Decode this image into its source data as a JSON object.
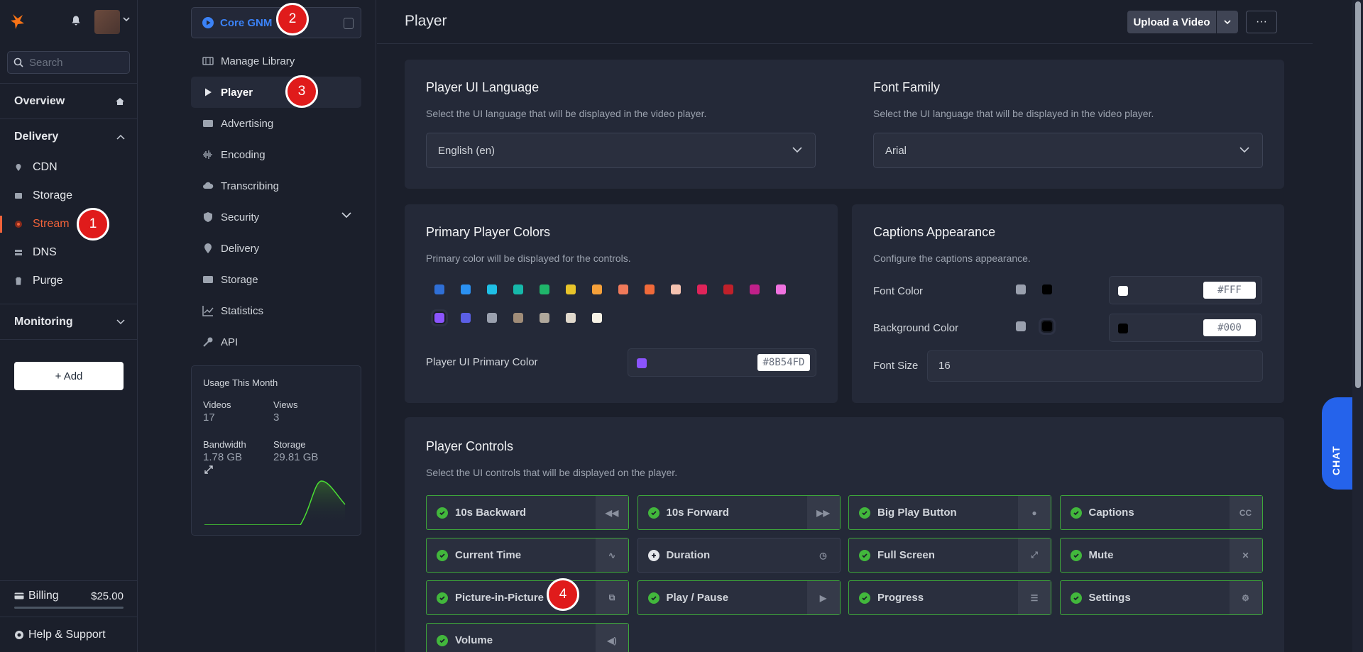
{
  "sidebar": {
    "search_placeholder": "Search",
    "overview": "Overview",
    "delivery": "Delivery",
    "items": [
      {
        "label": "CDN"
      },
      {
        "label": "Storage"
      },
      {
        "label": "Stream"
      },
      {
        "label": "DNS"
      },
      {
        "label": "Purge"
      }
    ],
    "monitoring": "Monitoring",
    "add": "+ Add",
    "billing_label": "Billing",
    "billing_amount": "$25.00",
    "help": "Help & Support"
  },
  "library": {
    "name": "Core GNM",
    "items": [
      {
        "label": "Manage Library"
      },
      {
        "label": "Player"
      },
      {
        "label": "Advertising"
      },
      {
        "label": "Encoding"
      },
      {
        "label": "Transcribing"
      },
      {
        "label": "Security"
      },
      {
        "label": "Delivery"
      },
      {
        "label": "Storage"
      },
      {
        "label": "Statistics"
      },
      {
        "label": "API"
      }
    ],
    "usage": {
      "title": "Usage This Month",
      "videos_label": "Videos",
      "videos": "17",
      "views_label": "Views",
      "views": "3",
      "bandwidth_label": "Bandwidth",
      "bandwidth": "1.78 GB",
      "storage_label": "Storage",
      "storage": "29.81 GB"
    }
  },
  "header": {
    "title": "Player",
    "upload": "Upload a Video",
    "more": "···"
  },
  "language": {
    "title": "Player UI Language",
    "desc": "Select the UI language that will be displayed in the video player.",
    "value": "English (en)"
  },
  "font": {
    "title": "Font Family",
    "desc": "Select the UI language that will be displayed in the video player.",
    "value": "Arial"
  },
  "colors": {
    "title": "Primary Player Colors",
    "desc": "Primary color will be displayed for the controls.",
    "swatches": [
      "#2f6fd6",
      "#2b91f2",
      "#1fbfe6",
      "#16b8aa",
      "#1fb56a",
      "#e8c42a",
      "#f5a03a",
      "#f07a5a",
      "#f06a3a",
      "#f5c2b0",
      "#e0245a",
      "#c0202a",
      "#c0208a",
      "#f072e0",
      "#8b54fd",
      "#5b5fe6",
      "#9aa0ae",
      "#a08c78",
      "#b0a89c",
      "#e0d8cc",
      "#f7f2e6"
    ],
    "primary_label": "Player UI Primary Color",
    "primary_hex": "#8B54FD",
    "primary_color": "#8B54FD"
  },
  "captions": {
    "title": "Captions Appearance",
    "desc": "Configure the captions appearance.",
    "font_color_label": "Font Color",
    "font_color_hex": "#FFF",
    "bg_color_label": "Background Color",
    "bg_color_hex": "#000",
    "font_size_label": "Font Size",
    "font_size": "16"
  },
  "controls": {
    "title": "Player Controls",
    "desc": "Select the UI controls that will be displayed on the player.",
    "items": [
      {
        "label": "10s Backward",
        "on": true,
        "icon": "rewind-icon"
      },
      {
        "label": "10s Forward",
        "on": true,
        "icon": "fast-forward-icon"
      },
      {
        "label": "Big Play Button",
        "on": true,
        "icon": "play-circle-icon"
      },
      {
        "label": "Captions",
        "on": true,
        "icon": "cc-icon"
      },
      {
        "label": "Current Time",
        "on": true,
        "icon": "wave-icon"
      },
      {
        "label": "Duration",
        "on": false,
        "icon": "timer-icon"
      },
      {
        "label": "Full Screen",
        "on": true,
        "icon": "expand-icon"
      },
      {
        "label": "Mute",
        "on": true,
        "icon": "mute-icon"
      },
      {
        "label": "Picture-in-Picture",
        "on": true,
        "icon": "external-icon"
      },
      {
        "label": "Play / Pause",
        "on": true,
        "icon": "play-icon"
      },
      {
        "label": "Progress",
        "on": true,
        "icon": "progress-icon"
      },
      {
        "label": "Settings",
        "on": true,
        "icon": "gear-icon"
      },
      {
        "label": "Volume",
        "on": true,
        "icon": "volume-icon"
      }
    ]
  },
  "chat": "CHAT",
  "badges": [
    "1",
    "2",
    "3",
    "4"
  ]
}
